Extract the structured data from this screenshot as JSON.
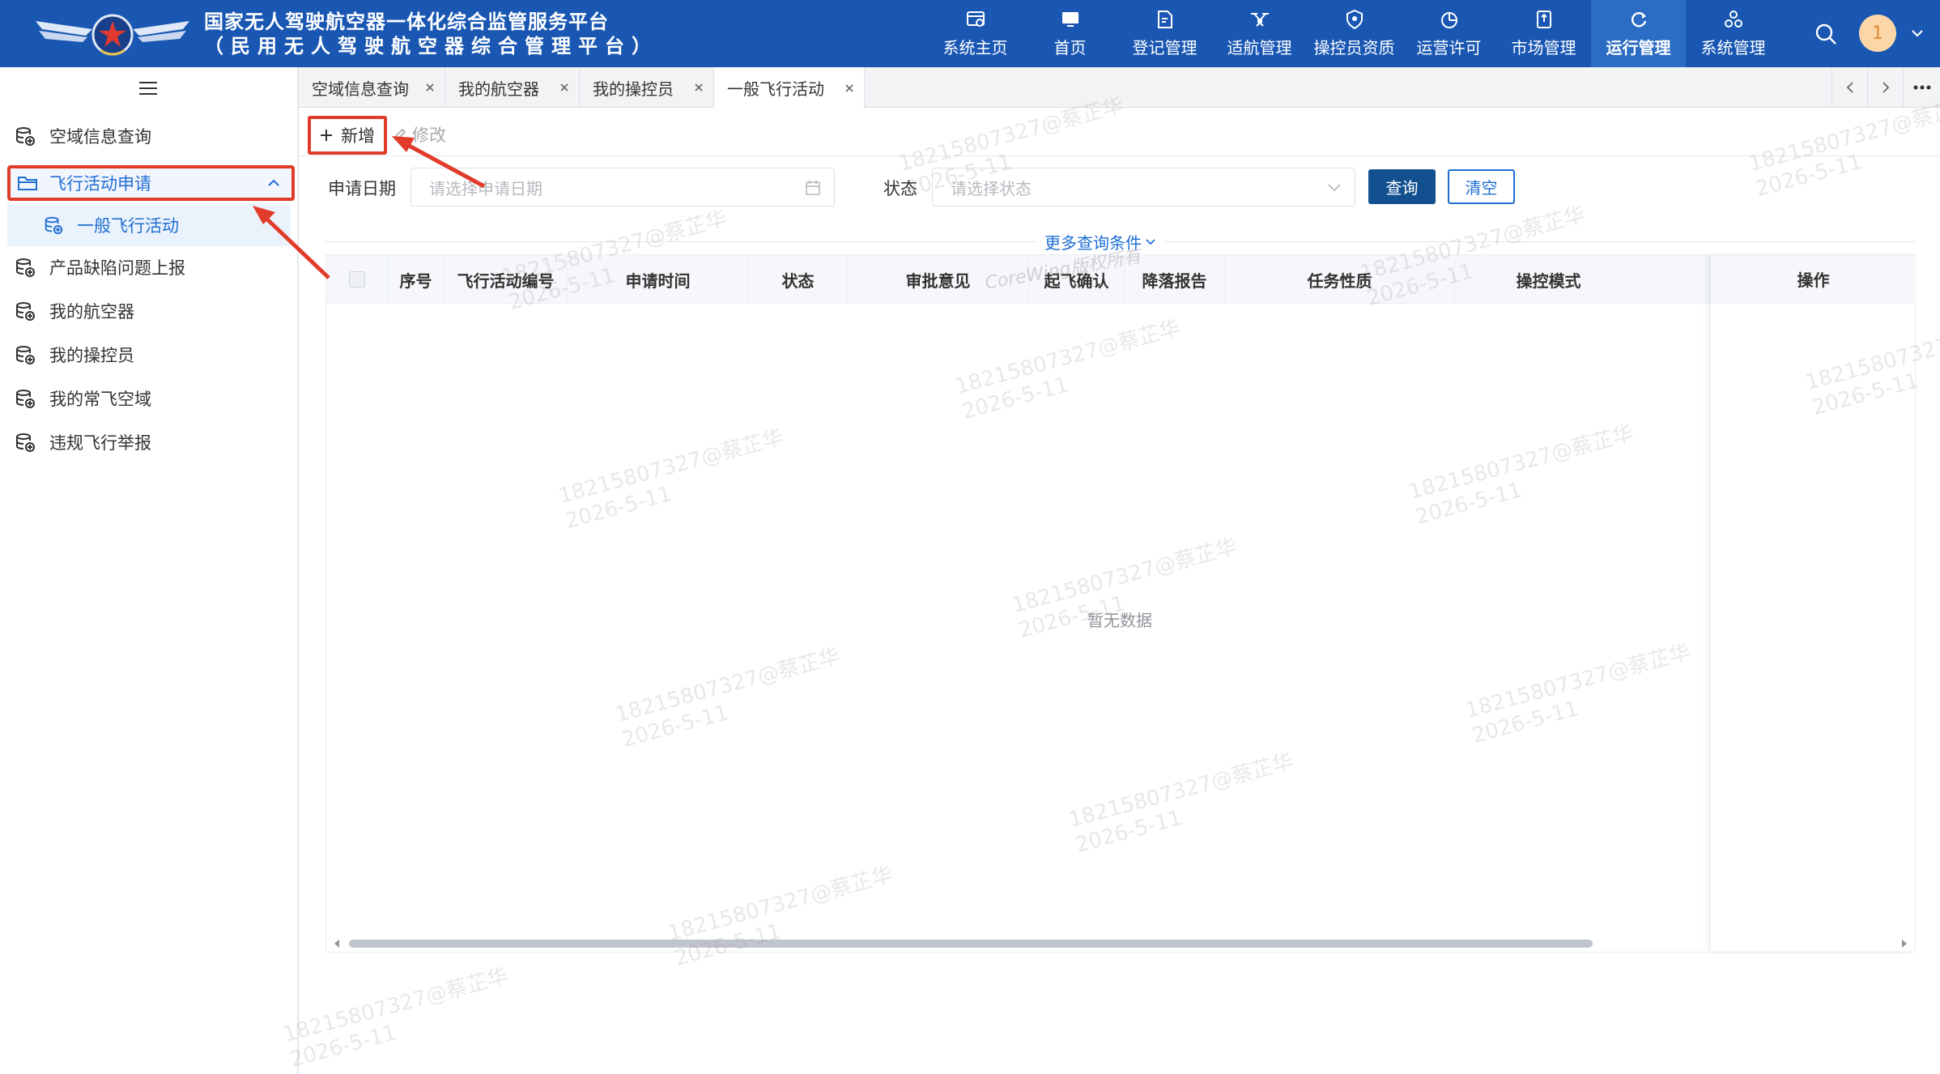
{
  "header": {
    "title_line1": "国家无人驾驶航空器一体化综合监管服务平台",
    "title_line2": "（民用无人驾驶航空器综合管理平台）",
    "nav": [
      {
        "label": "系统主页",
        "icon": "home-window-icon"
      },
      {
        "label": "首页",
        "icon": "monitor-icon"
      },
      {
        "label": "登记管理",
        "icon": "document-edit-icon"
      },
      {
        "label": "适航管理",
        "icon": "drone-icon"
      },
      {
        "label": "操控员资质",
        "icon": "shield-icon"
      },
      {
        "label": "运营许可",
        "icon": "pie-chart-icon"
      },
      {
        "label": "市场管理",
        "icon": "badge-icon"
      },
      {
        "label": "运行管理",
        "icon": "refresh-icon"
      },
      {
        "label": "系统管理",
        "icon": "settings-cluster-icon"
      }
    ],
    "active_nav": "运行管理",
    "avatar_text": "1"
  },
  "sidebar": {
    "items": [
      {
        "label": "空域信息查询"
      },
      {
        "label": "飞行活动申请"
      },
      {
        "label": "一般飞行活动"
      },
      {
        "label": "产品缺陷问题上报"
      },
      {
        "label": "我的航空器"
      },
      {
        "label": "我的操控员"
      },
      {
        "label": "我的常飞空域"
      },
      {
        "label": "违规飞行举报"
      }
    ]
  },
  "tabs": [
    {
      "label": "空域信息查询"
    },
    {
      "label": "我的航空器"
    },
    {
      "label": "我的操控员"
    },
    {
      "label": "一般飞行活动"
    }
  ],
  "toolbar": {
    "add_label": "新增",
    "edit_label": "修改"
  },
  "search": {
    "date_label": "申请日期",
    "date_placeholder": "请选择申请日期",
    "status_label": "状态",
    "status_placeholder": "请选择状态",
    "query_label": "查询",
    "clear_label": "清空",
    "more_label": "更多查询条件"
  },
  "table": {
    "columns": [
      "序号",
      "飞行活动编号",
      "申请时间",
      "状态",
      "审批意见",
      "起飞确认",
      "降落报告",
      "任务性质",
      "操控模式"
    ],
    "action_column": "操作",
    "empty_text": "暂无数据"
  },
  "watermark": {
    "line1": "18215807327@蔡芷华",
    "line2": "2026-5-11",
    "copyright": "CoreWing版权所有"
  },
  "colors": {
    "header_bg": "#1957b3",
    "active_nav_bg": "#2b6cc4",
    "accent_blue": "#1f6ed4",
    "query_button": "#12508f",
    "highlight_red": "#e13b2a"
  }
}
